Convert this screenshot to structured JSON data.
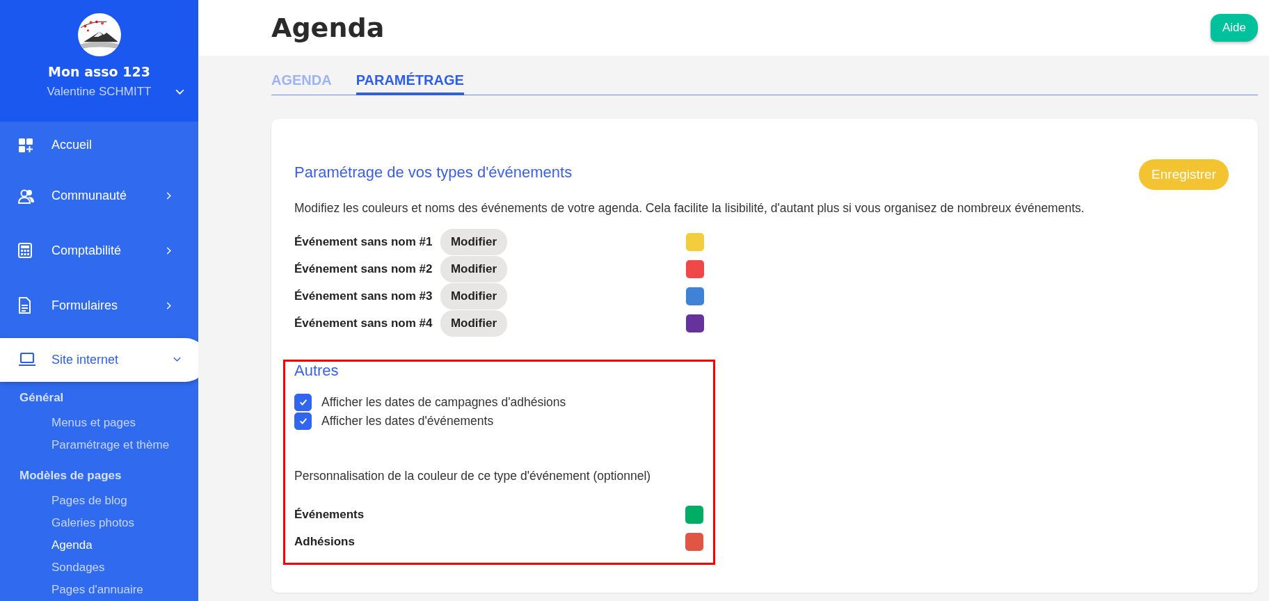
{
  "sidebar": {
    "org_name": "Mon asso 123",
    "user_name": "Valentine SCHMITT",
    "nav": [
      {
        "label": "Accueil",
        "selected": false
      },
      {
        "label": "Communauté",
        "expanded": false,
        "selected": false
      },
      {
        "label": "Comptabilité",
        "expanded": false,
        "selected": false
      },
      {
        "label": "Formulaires",
        "expanded": false,
        "selected": false
      },
      {
        "label": "Site internet",
        "expanded": true,
        "selected": true
      }
    ],
    "groups": [
      {
        "title": "Général",
        "items": [
          {
            "label": "Menus et pages",
            "selected": false
          },
          {
            "label": "Paramétrage et thème",
            "selected": false
          }
        ]
      },
      {
        "title": "Modèles de pages",
        "items": [
          {
            "label": "Pages de blog",
            "selected": false
          },
          {
            "label": "Galeries photos",
            "selected": false
          },
          {
            "label": "Agenda",
            "selected": true
          },
          {
            "label": "Sondages",
            "selected": false
          },
          {
            "label": "Pages d'annuaire",
            "selected": false
          }
        ]
      }
    ]
  },
  "page": {
    "title": "Agenda",
    "help_button": "Aide"
  },
  "tabs": [
    {
      "label": "AGENDA",
      "selected": false
    },
    {
      "label": "PARAMÉTRAGE",
      "selected": true
    }
  ],
  "event_types": {
    "title": "Paramétrage de vos types d'événements",
    "save_button": "Enregistrer",
    "description": "Modifiez les couleurs et noms des événements de votre agenda. Cela facilite la lisibilité, d'autant plus si vous organisez de nombreux événements.",
    "rows": [
      {
        "name": "Événement sans nom #1",
        "button": "Modifier",
        "color": "#f3cd3d"
      },
      {
        "name": "Événement sans nom #2",
        "button": "Modifier",
        "color": "#f04848"
      },
      {
        "name": "Événement sans nom #3",
        "button": "Modifier",
        "color": "#3f82d6"
      },
      {
        "name": "Événement sans nom #4",
        "button": "Modifier",
        "color": "#653399"
      }
    ]
  },
  "others": {
    "title": "Autres",
    "options": [
      {
        "label": "Afficher les dates de campagnes d'adhésions",
        "checked": true
      },
      {
        "label": "Afficher les dates d'événements",
        "checked": true
      }
    ],
    "color_hint": "Personnalisation de la couleur de ce type d'événement (optionnel)",
    "colors": [
      {
        "name": "Événements",
        "color": "#00ad65"
      },
      {
        "name": "Adhésions",
        "color": "#e05544"
      }
    ]
  }
}
